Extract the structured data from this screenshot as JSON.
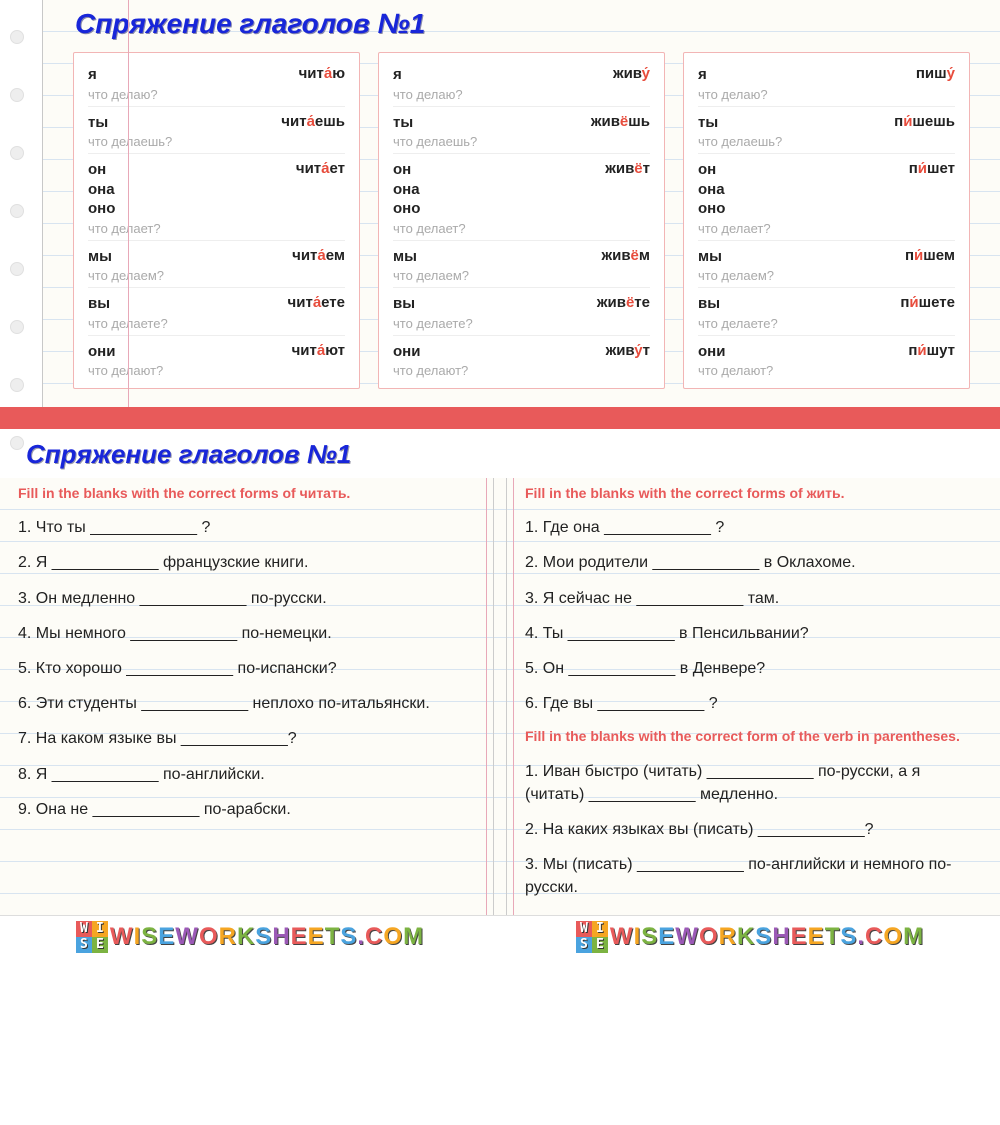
{
  "main_title": "Спряжение глаголов №1",
  "cards": [
    {
      "rows": [
        {
          "pronoun": "я",
          "pre": "чит",
          "stress": "а́",
          "post": "ю",
          "q": "что делаю?"
        },
        {
          "pronoun": "ты",
          "pre": "чит",
          "stress": "а́",
          "post": "ешь",
          "q": "что делаешь?"
        },
        {
          "pronoun": "он\nона\nоно",
          "pre": "чит",
          "stress": "а́",
          "post": "ет",
          "q": "что делает?"
        },
        {
          "pronoun": "мы",
          "pre": "чит",
          "stress": "а́",
          "post": "ем",
          "q": "что делаем?"
        },
        {
          "pronoun": "вы",
          "pre": "чит",
          "stress": "а́",
          "post": "ете",
          "q": "что делаете?"
        },
        {
          "pronoun": "они",
          "pre": "чит",
          "stress": "а́",
          "post": "ют",
          "q": "что делают?"
        }
      ]
    },
    {
      "rows": [
        {
          "pronoun": "я",
          "pre": "жив",
          "stress": "у́",
          "post": "",
          "q": "что делаю?"
        },
        {
          "pronoun": "ты",
          "pre": "жив",
          "stress": "ё",
          "post": "шь",
          "q": "что делаешь?"
        },
        {
          "pronoun": "он\nона\nоно",
          "pre": "жив",
          "stress": "ё",
          "post": "т",
          "q": "что делает?"
        },
        {
          "pronoun": "мы",
          "pre": "жив",
          "stress": "ё",
          "post": "м",
          "q": "что делаем?"
        },
        {
          "pronoun": "вы",
          "pre": "жив",
          "stress": "ё",
          "post": "те",
          "q": "что делаете?"
        },
        {
          "pronoun": "они",
          "pre": "жив",
          "stress": "у́",
          "post": "т",
          "q": "что делают?"
        }
      ]
    },
    {
      "rows": [
        {
          "pronoun": "я",
          "pre": "пиш",
          "stress": "у́",
          "post": "",
          "q": "что делаю?"
        },
        {
          "pronoun": "ты",
          "pre": "п",
          "stress": "и́",
          "post": "шешь",
          "q": "что делаешь?"
        },
        {
          "pronoun": "он\nона\nоно",
          "pre": "п",
          "stress": "и́",
          "post": "шет",
          "q": "что делает?"
        },
        {
          "pronoun": "мы",
          "pre": "п",
          "stress": "и́",
          "post": "шем",
          "q": "что делаем?"
        },
        {
          "pronoun": "вы",
          "pre": "п",
          "stress": "и́",
          "post": "шете",
          "q": "что делаете?"
        },
        {
          "pronoun": "они",
          "pre": "п",
          "stress": "и́",
          "post": "шут",
          "q": "что делают?"
        }
      ]
    }
  ],
  "title2": "Спряжение глаголов №1",
  "left": {
    "instruction": "Fill in the blanks with the correct forms of читать.",
    "lines": [
      "1. Что ты ____________ ?",
      "2. Я ____________ французские книги.",
      "3. Он медленно ____________ по-русски.",
      "4. Мы немного ____________ по-немецки.",
      "5. Кто хорошо ____________ по-испански?",
      "6. Эти студенты ____________ неплохо по-итальянски.",
      "7. На каком языке вы ____________?",
      "8. Я ____________ по-английски.",
      "9. Она не ____________ по-арабски."
    ]
  },
  "right": {
    "instruction1": "Fill in the blanks with the correct forms of жить.",
    "lines1": [
      "1. Где она ____________ ?",
      "2. Мои родители ____________ в Оклахоме.",
      "3. Я сейчас не ____________ там.",
      "4. Ты ____________ в Пенсильвании?",
      "5. Он ____________ в Денвере?",
      "6. Где вы ____________ ?"
    ],
    "instruction2": "Fill in the blanks with the correct form of the verb in parentheses.",
    "lines2": [
      "1. Иван быстро (читать) ____________ по-русски, а я (читать) ____________ медленно.",
      "2. На каких языках вы (писать) ____________?",
      "3. Мы (писать) ____________ по-английски и немного по-русски."
    ]
  },
  "watermark": "WISEWORKSHEETS.COM",
  "cube": [
    "W",
    "I",
    "S",
    "E"
  ]
}
